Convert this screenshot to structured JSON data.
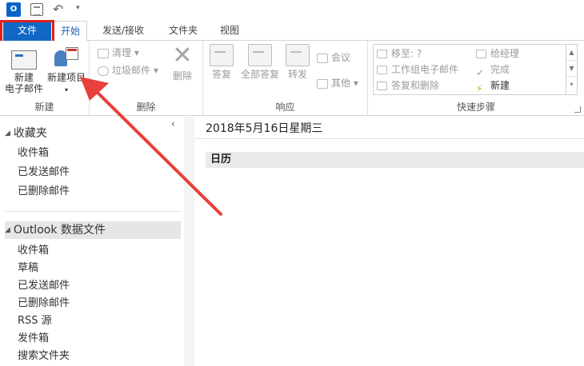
{
  "qat": {
    "logo_text": "O",
    "icons": [
      "outlook-logo-icon",
      "send-receive-icon",
      "undo-icon",
      "customize-icon"
    ]
  },
  "tabs": [
    {
      "label": "文件"
    },
    {
      "label": "开始"
    },
    {
      "label": "发送/接收"
    },
    {
      "label": "文件夹"
    },
    {
      "label": "视图"
    }
  ],
  "ribbon": {
    "new_group": {
      "label": "新建",
      "new_email_line1": "新建",
      "new_email_line2": "电子邮件",
      "new_item_line1": "新建项目",
      "new_item_arrow": "▾"
    },
    "delete_group": {
      "label": "删除",
      "cleanup": "清理 ▾",
      "junk": "垃圾邮件 ▾",
      "delete": "删除"
    },
    "respond_group": {
      "label": "响应",
      "reply": "答复",
      "reply_all": "全部答复",
      "forward": "转发",
      "meeting": "会议",
      "more": "其他 ▾"
    },
    "quick_steps": {
      "label": "快速步骤",
      "items": [
        {
          "label": "移至: ?"
        },
        {
          "label": "给经理"
        },
        {
          "label": "工作组电子邮件"
        },
        {
          "label": "完成"
        },
        {
          "label": "答复和删除"
        },
        {
          "label": "新建"
        }
      ]
    }
  },
  "nav": {
    "favorites": {
      "header": "收藏夹",
      "items": [
        "收件箱",
        "已发送邮件",
        "已删除邮件"
      ]
    },
    "data_file": {
      "header": "Outlook 数据文件",
      "items": [
        "收件箱",
        "草稿",
        "已发送邮件",
        "已删除邮件",
        "RSS 源",
        "发件箱",
        "搜索文件夹"
      ]
    },
    "collapse_glyph": "‹"
  },
  "main": {
    "date": "2018年5月16日星期三",
    "calendar_label": "日历"
  },
  "colors": {
    "file_tab": "#1068c4",
    "highlight": "#e02020",
    "arrow": "#e8403a"
  }
}
